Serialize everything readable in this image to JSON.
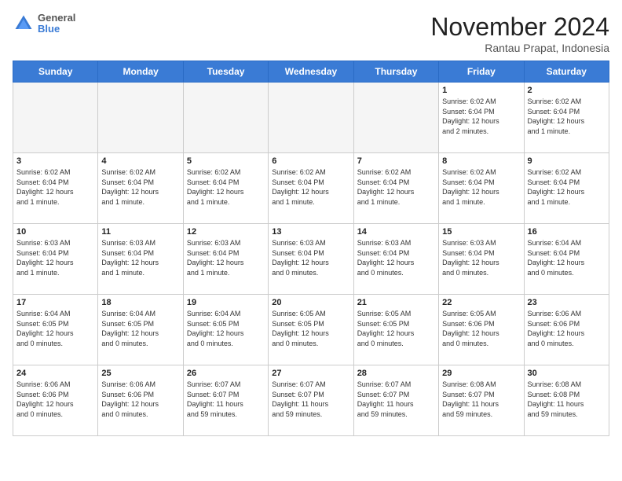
{
  "header": {
    "logo_line1": "General",
    "logo_line2": "Blue",
    "month": "November 2024",
    "location": "Rantau Prapat, Indonesia"
  },
  "weekdays": [
    "Sunday",
    "Monday",
    "Tuesday",
    "Wednesday",
    "Thursday",
    "Friday",
    "Saturday"
  ],
  "weeks": [
    [
      {
        "day": "",
        "info": ""
      },
      {
        "day": "",
        "info": ""
      },
      {
        "day": "",
        "info": ""
      },
      {
        "day": "",
        "info": ""
      },
      {
        "day": "",
        "info": ""
      },
      {
        "day": "1",
        "info": "Sunrise: 6:02 AM\nSunset: 6:04 PM\nDaylight: 12 hours\nand 2 minutes."
      },
      {
        "day": "2",
        "info": "Sunrise: 6:02 AM\nSunset: 6:04 PM\nDaylight: 12 hours\nand 1 minute."
      }
    ],
    [
      {
        "day": "3",
        "info": "Sunrise: 6:02 AM\nSunset: 6:04 PM\nDaylight: 12 hours\nand 1 minute."
      },
      {
        "day": "4",
        "info": "Sunrise: 6:02 AM\nSunset: 6:04 PM\nDaylight: 12 hours\nand 1 minute."
      },
      {
        "day": "5",
        "info": "Sunrise: 6:02 AM\nSunset: 6:04 PM\nDaylight: 12 hours\nand 1 minute."
      },
      {
        "day": "6",
        "info": "Sunrise: 6:02 AM\nSunset: 6:04 PM\nDaylight: 12 hours\nand 1 minute."
      },
      {
        "day": "7",
        "info": "Sunrise: 6:02 AM\nSunset: 6:04 PM\nDaylight: 12 hours\nand 1 minute."
      },
      {
        "day": "8",
        "info": "Sunrise: 6:02 AM\nSunset: 6:04 PM\nDaylight: 12 hours\nand 1 minute."
      },
      {
        "day": "9",
        "info": "Sunrise: 6:02 AM\nSunset: 6:04 PM\nDaylight: 12 hours\nand 1 minute."
      }
    ],
    [
      {
        "day": "10",
        "info": "Sunrise: 6:03 AM\nSunset: 6:04 PM\nDaylight: 12 hours\nand 1 minute."
      },
      {
        "day": "11",
        "info": "Sunrise: 6:03 AM\nSunset: 6:04 PM\nDaylight: 12 hours\nand 1 minute."
      },
      {
        "day": "12",
        "info": "Sunrise: 6:03 AM\nSunset: 6:04 PM\nDaylight: 12 hours\nand 1 minute."
      },
      {
        "day": "13",
        "info": "Sunrise: 6:03 AM\nSunset: 6:04 PM\nDaylight: 12 hours\nand 0 minutes."
      },
      {
        "day": "14",
        "info": "Sunrise: 6:03 AM\nSunset: 6:04 PM\nDaylight: 12 hours\nand 0 minutes."
      },
      {
        "day": "15",
        "info": "Sunrise: 6:03 AM\nSunset: 6:04 PM\nDaylight: 12 hours\nand 0 minutes."
      },
      {
        "day": "16",
        "info": "Sunrise: 6:04 AM\nSunset: 6:04 PM\nDaylight: 12 hours\nand 0 minutes."
      }
    ],
    [
      {
        "day": "17",
        "info": "Sunrise: 6:04 AM\nSunset: 6:05 PM\nDaylight: 12 hours\nand 0 minutes."
      },
      {
        "day": "18",
        "info": "Sunrise: 6:04 AM\nSunset: 6:05 PM\nDaylight: 12 hours\nand 0 minutes."
      },
      {
        "day": "19",
        "info": "Sunrise: 6:04 AM\nSunset: 6:05 PM\nDaylight: 12 hours\nand 0 minutes."
      },
      {
        "day": "20",
        "info": "Sunrise: 6:05 AM\nSunset: 6:05 PM\nDaylight: 12 hours\nand 0 minutes."
      },
      {
        "day": "21",
        "info": "Sunrise: 6:05 AM\nSunset: 6:05 PM\nDaylight: 12 hours\nand 0 minutes."
      },
      {
        "day": "22",
        "info": "Sunrise: 6:05 AM\nSunset: 6:06 PM\nDaylight: 12 hours\nand 0 minutes."
      },
      {
        "day": "23",
        "info": "Sunrise: 6:06 AM\nSunset: 6:06 PM\nDaylight: 12 hours\nand 0 minutes."
      }
    ],
    [
      {
        "day": "24",
        "info": "Sunrise: 6:06 AM\nSunset: 6:06 PM\nDaylight: 12 hours\nand 0 minutes."
      },
      {
        "day": "25",
        "info": "Sunrise: 6:06 AM\nSunset: 6:06 PM\nDaylight: 12 hours\nand 0 minutes."
      },
      {
        "day": "26",
        "info": "Sunrise: 6:07 AM\nSunset: 6:07 PM\nDaylight: 11 hours\nand 59 minutes."
      },
      {
        "day": "27",
        "info": "Sunrise: 6:07 AM\nSunset: 6:07 PM\nDaylight: 11 hours\nand 59 minutes."
      },
      {
        "day": "28",
        "info": "Sunrise: 6:07 AM\nSunset: 6:07 PM\nDaylight: 11 hours\nand 59 minutes."
      },
      {
        "day": "29",
        "info": "Sunrise: 6:08 AM\nSunset: 6:07 PM\nDaylight: 11 hours\nand 59 minutes."
      },
      {
        "day": "30",
        "info": "Sunrise: 6:08 AM\nSunset: 6:08 PM\nDaylight: 11 hours\nand 59 minutes."
      }
    ]
  ]
}
